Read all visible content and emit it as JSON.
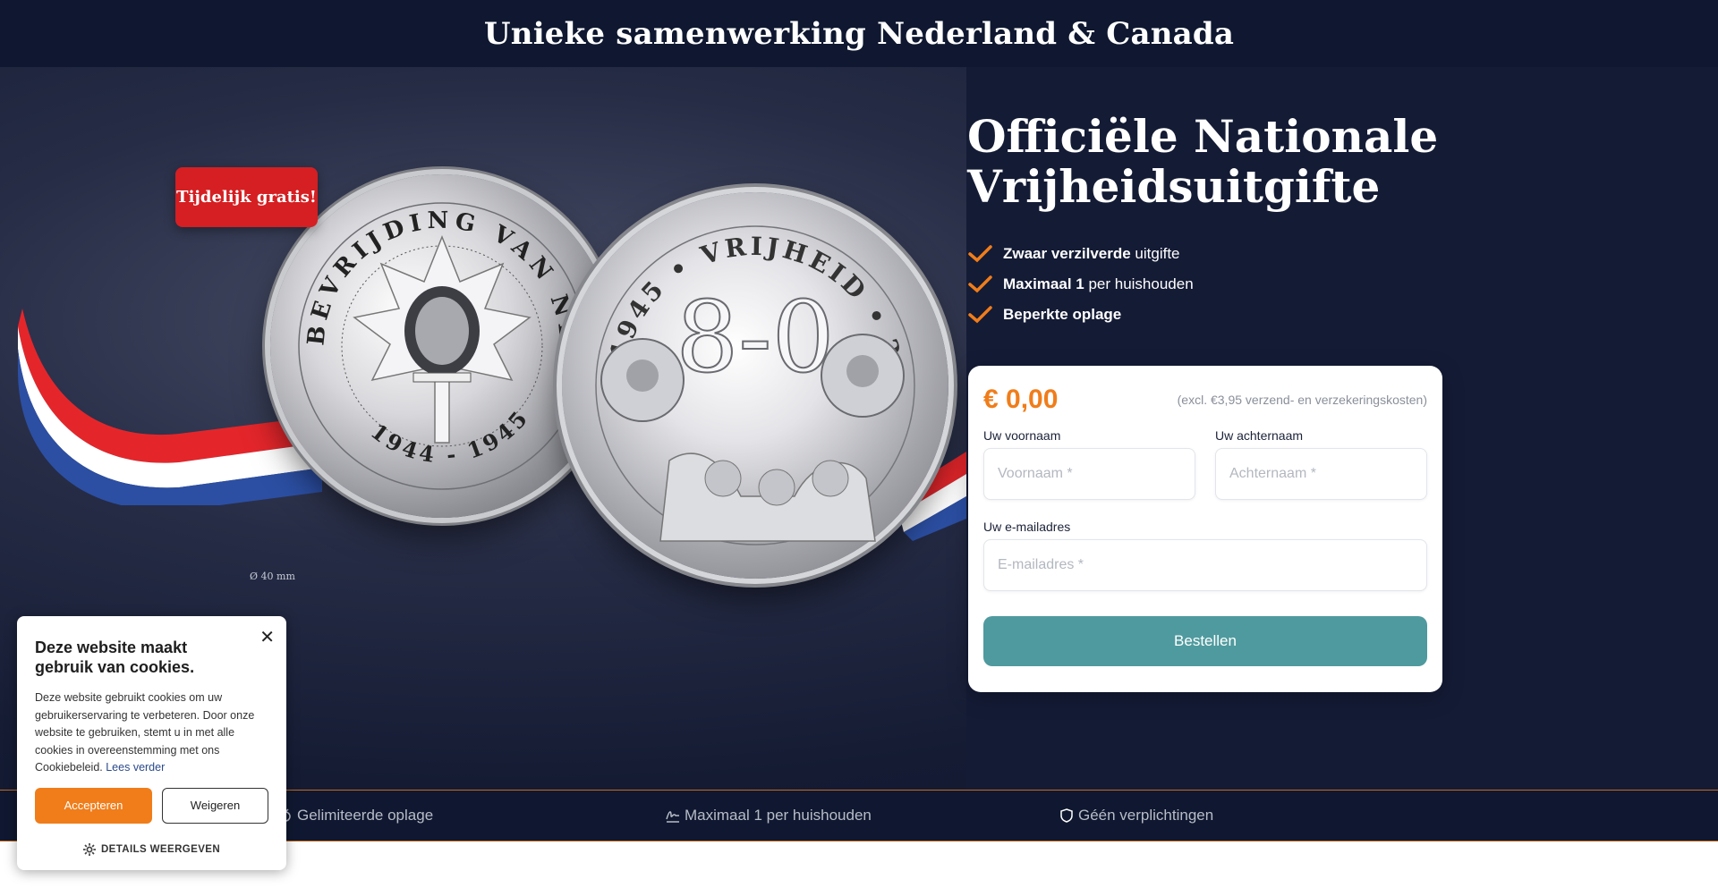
{
  "header": {
    "title": "Unieke samenwerking Nederland & Canada"
  },
  "hero": {
    "badge": "Tijdelijk gratis!",
    "diameter": "Ø 40 mm",
    "coin_left_legend": "BEVRIJDING VAN NEDERLAND",
    "coin_left_years": "1944 - 1945",
    "coin_right_top": "1945 • VRIJHEID • 2025",
    "coin_right_number": "8-0",
    "headline_line1": "Officiële Nationale",
    "headline_line2": "Vrijheidsuitgifte",
    "features": [
      {
        "bold": "Zwaar verzilverde",
        "rest": " uitgifte"
      },
      {
        "bold": "Maximaal 1",
        "rest": " per huishouden"
      },
      {
        "bold": "Beperkte oplage",
        "rest": ""
      }
    ]
  },
  "order_form": {
    "price": "€ 0,00",
    "shipping_note": "(excl. €3,95 verzend- en verzekeringskosten)",
    "first_name_label": "Uw voornaam",
    "first_name_placeholder": "Voornaam *",
    "last_name_label": "Uw achternaam",
    "last_name_placeholder": "Achternaam *",
    "email_label": "Uw e-mailadres",
    "email_placeholder": "E-mailadres *",
    "submit_label": "Bestellen"
  },
  "bottom_bar": {
    "items": [
      {
        "label": "Gelimiteerde oplage",
        "icon": "medal-icon"
      },
      {
        "label": "Maximaal 1 per huishouden",
        "icon": "signature-icon"
      },
      {
        "label": "Géén verplichtingen",
        "icon": "shield-icon"
      }
    ]
  },
  "cookie_banner": {
    "title": "Deze website maakt gebruik van cookies.",
    "body": "Deze website gebruikt cookies om uw gebruikerservaring te verbeteren. Door onze website te gebruiken, stemt u in met alle cookies in overeenstemming met ons Cookiebeleid.",
    "read_more": "Lees verder",
    "accept_label": "Accepteren",
    "decline_label": "Weigeren",
    "details_label": "DETAILS WEERGEVEN"
  },
  "colors": {
    "navy": "#0f1830",
    "accent_orange": "#f07d1a",
    "badge_red": "#d51f22",
    "button_teal": "#4f9a9e"
  }
}
